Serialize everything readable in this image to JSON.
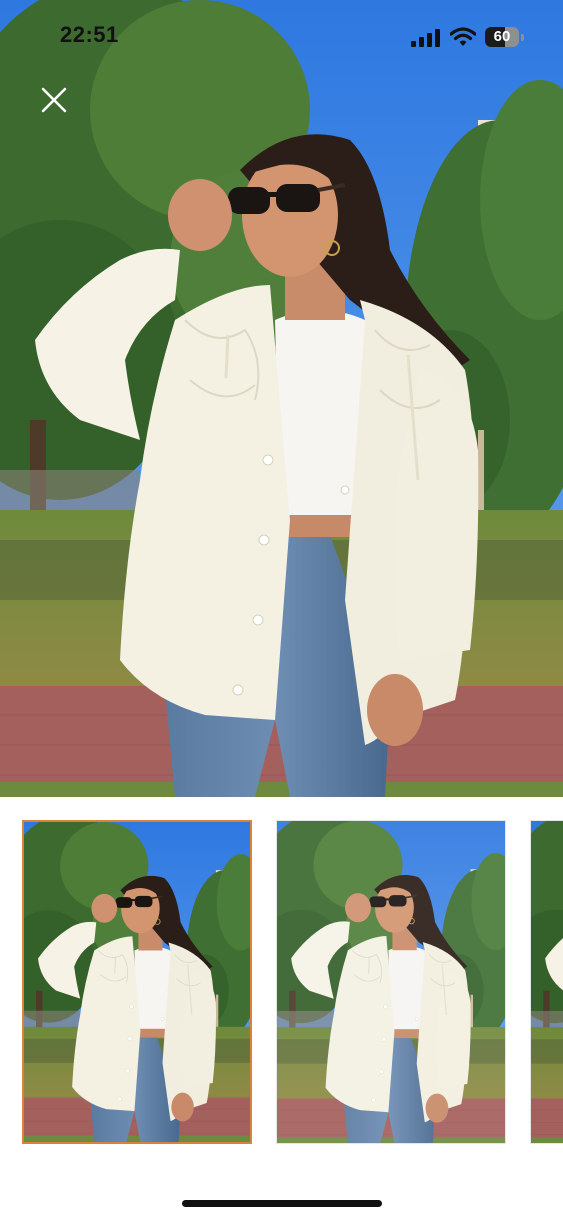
{
  "status_bar": {
    "time": "22:51",
    "battery_level": "60",
    "battery_fraction": 0.6,
    "signal_icon": "cellular-signal-icon",
    "wifi_icon": "wifi-icon"
  },
  "viewer": {
    "close_icon": "close-icon",
    "main_image": "product-photo-main",
    "selected_index": 0
  },
  "gallery": {
    "thumbnails": [
      {
        "name": "product-photo-1",
        "selected": true
      },
      {
        "name": "product-photo-2",
        "selected": false
      },
      {
        "name": "product-photo-3",
        "selected": false
      }
    ]
  },
  "colors": {
    "sky": "#3f8ae8",
    "foliage": "#3f6d31",
    "jacket": "#f4f1e3",
    "jeans": "#4f6f94",
    "selected_border": "#d9823a",
    "pavement": "#9b5a5a"
  }
}
